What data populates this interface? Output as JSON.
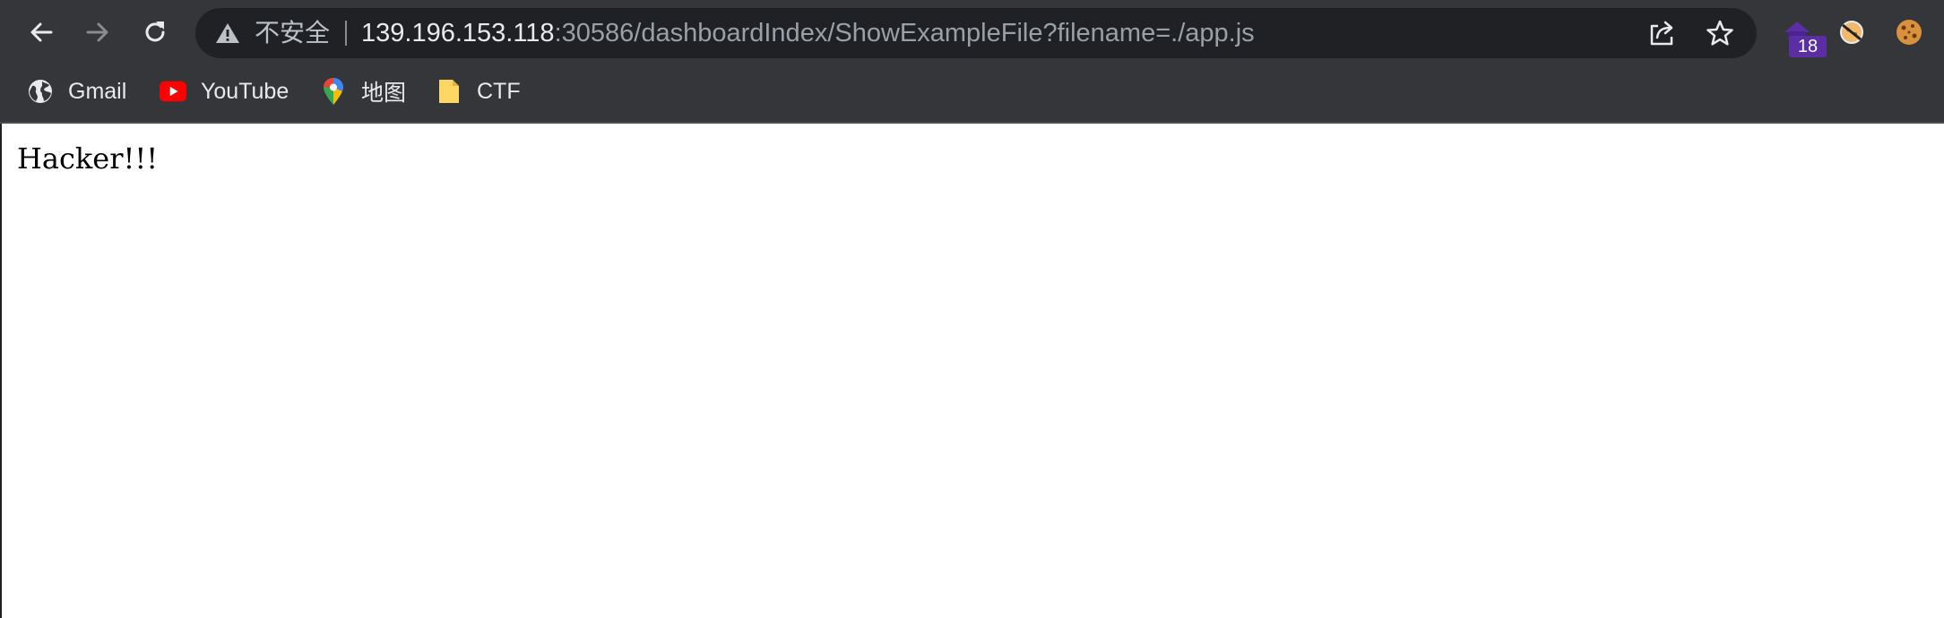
{
  "browser": {
    "security_label": "不安全",
    "url_host": "139.196.153.118",
    "url_path": ":30586/dashboardIndex/ShowExampleFile?filename=./app.js",
    "extension_badge_count": "18",
    "icons": {
      "back": "arrow-left-icon",
      "forward": "arrow-right-icon",
      "reload": "reload-icon",
      "warning": "warning-triangle-icon",
      "share": "share-icon",
      "bookmark_star": "star-icon"
    },
    "colors": {
      "chrome_bg": "#35363a",
      "omnibox_bg": "#202124",
      "badge_bg": "#5b2ea6"
    }
  },
  "bookmarks": [
    {
      "label": "Gmail",
      "icon": "globe-icon"
    },
    {
      "label": "YouTube",
      "icon": "youtube-icon"
    },
    {
      "label": "地图",
      "icon": "maps-pin-icon"
    },
    {
      "label": "CTF",
      "icon": "folder-icon"
    }
  ],
  "page": {
    "body_text": "Hacker!!!"
  }
}
